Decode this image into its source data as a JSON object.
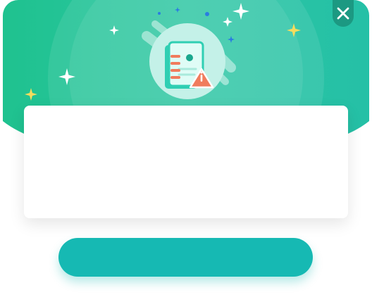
{
  "dialog": {
    "card_message": "",
    "action_label": ""
  },
  "icons": {
    "close": "close-icon",
    "illustration": "notebook-warning-icon"
  },
  "colors": {
    "header_start": "#1fc28f",
    "header_end": "#25c0a6",
    "button": "#16b9b3",
    "warning": "#f07c5d",
    "notebook": "#2fcfb3",
    "star_yellow": "#f4dc5e",
    "star_white": "#ffffff",
    "dot_blue": "#2a7de1"
  }
}
